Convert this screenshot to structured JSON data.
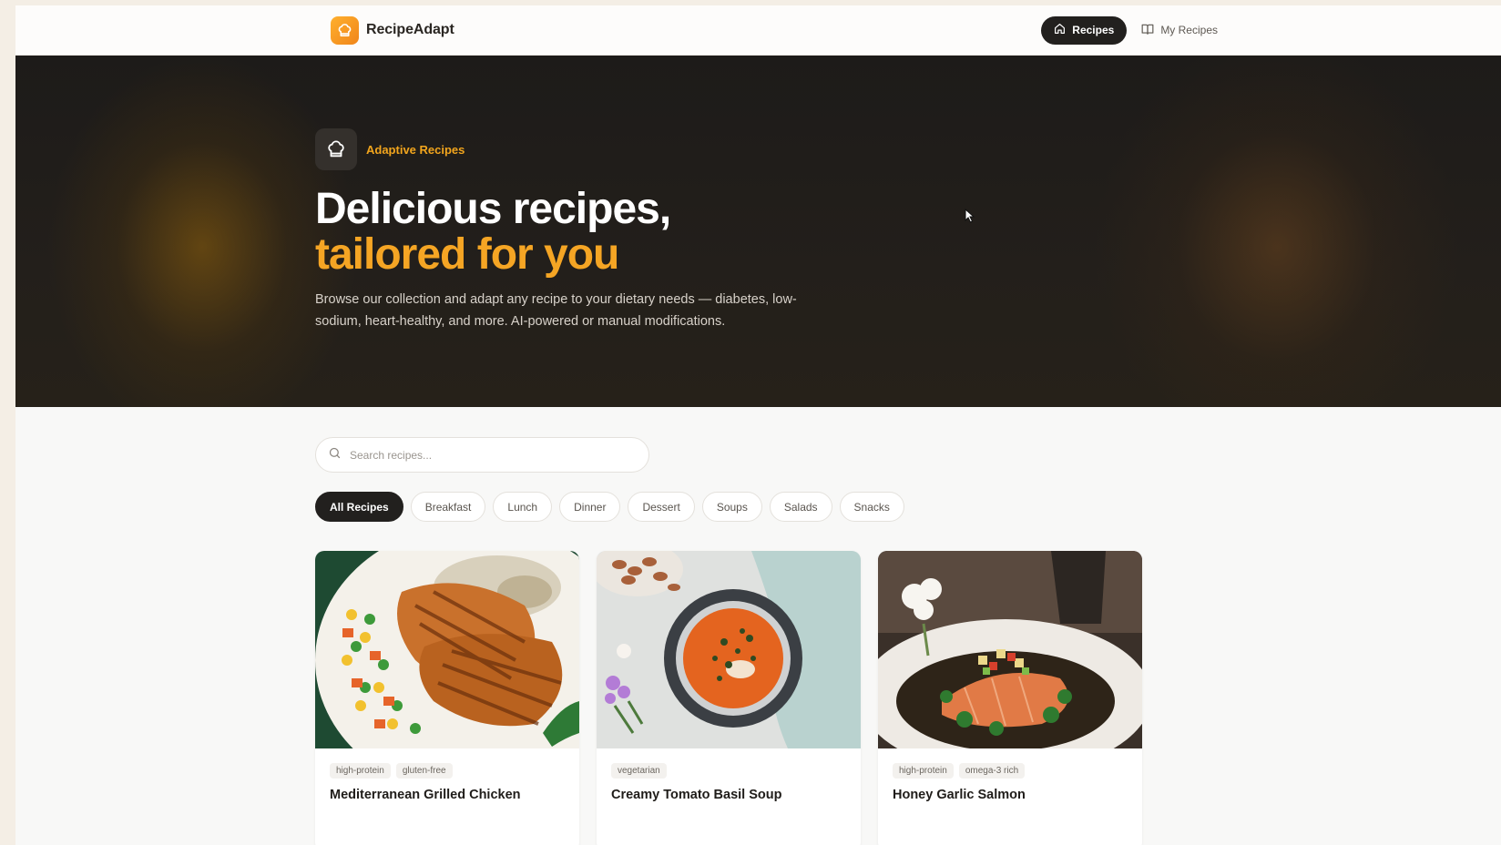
{
  "header": {
    "brand_name": "RecipeAdapt",
    "nav": [
      {
        "label": "Recipes",
        "icon": "home-icon",
        "active": true
      },
      {
        "label": "My Recipes",
        "icon": "book-icon",
        "active": false
      }
    ]
  },
  "hero": {
    "badge_text": "Adaptive Recipes",
    "badge_icon": "chef-hat-icon",
    "title_line1": "Delicious recipes,",
    "title_line2": "tailored for you",
    "description": "Browse our collection and adapt any recipe to your dietary needs — diabetes, low-sodium, heart-healthy, and more. AI-powered or manual modifications."
  },
  "search": {
    "placeholder": "Search recipes...",
    "value": ""
  },
  "filters": [
    "All Recipes",
    "Breakfast",
    "Lunch",
    "Dinner",
    "Dessert",
    "Soups",
    "Salads",
    "Snacks"
  ],
  "active_filter": "All Recipes",
  "recipes": [
    {
      "title": "Mediterranean Grilled Chicken",
      "tags": [
        "high-protein",
        "gluten-free"
      ]
    },
    {
      "title": "Creamy Tomato Basil Soup",
      "tags": [
        "vegetarian"
      ]
    },
    {
      "title": "Honey Garlic Salmon",
      "tags": [
        "high-protein",
        "omega-3 rich"
      ]
    }
  ],
  "colors": {
    "accent": "#f5a524",
    "dark": "#22201e",
    "hero_bg": "#1d1b19",
    "page_bg": "#f8f8f7"
  }
}
